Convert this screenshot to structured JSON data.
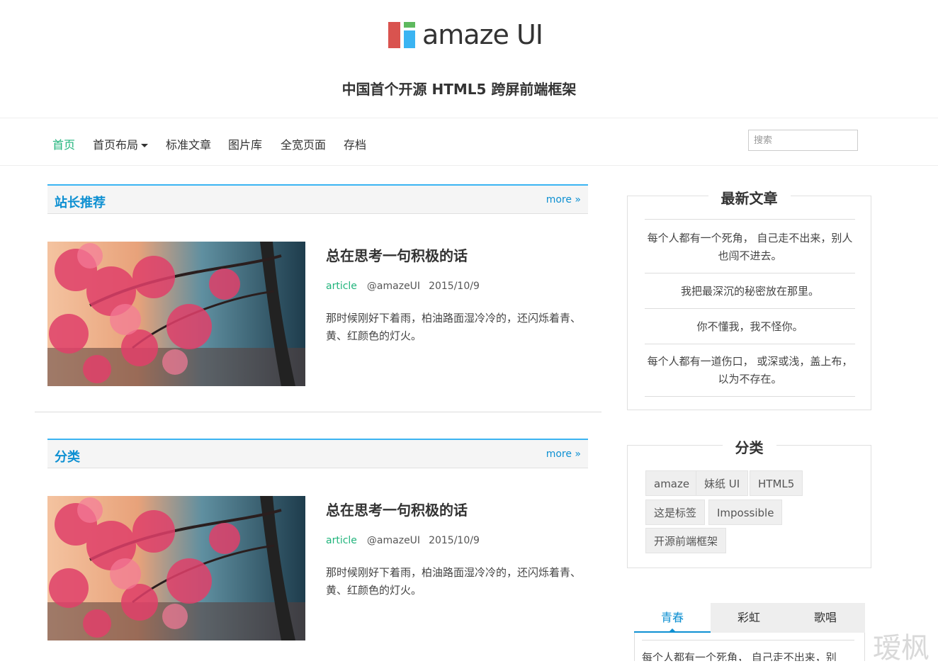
{
  "header": {
    "logo_text": "amaze UI",
    "tagline": "中国首个开源 HTML5 跨屏前端框架"
  },
  "nav": {
    "items": [
      "首页",
      "首页布局",
      "标准文章",
      "图片库",
      "全宽页面",
      "存档"
    ],
    "search_placeholder": "搜索"
  },
  "sections": [
    {
      "title": "站长推荐",
      "more": "more »",
      "post": {
        "title": "总在思考一句积极的话",
        "category": "article",
        "author": "@amazeUI",
        "date": "2015/10/9",
        "summary": "那时候刚好下着雨，柏油路面湿冷冷的，还闪烁着青、黄、红颜色的灯火。"
      }
    },
    {
      "title": "分类",
      "more": "more »",
      "post": {
        "title": "总在思考一句积极的话",
        "category": "article",
        "author": "@amazeUI",
        "date": "2015/10/9",
        "summary": "那时候刚好下着雨，柏油路面湿冷冷的，还闪烁着青、黄、红颜色的灯火。"
      }
    }
  ],
  "sidebar": {
    "latest": {
      "title": "最新文章",
      "items": [
        "每个人都有一个死角， 自己走不出来，别人也闯不进去。",
        "我把最深沉的秘密放在那里。",
        "你不懂我，我不怪你。",
        "每个人都有一道伤口， 或深或浅，盖上布，以为不存在。"
      ]
    },
    "categories": {
      "title": "分类",
      "tags": [
        "amaze",
        "妹纸 UI",
        "HTML5",
        "这是标签",
        "Impossible",
        "开源前端框架"
      ]
    },
    "tabs": {
      "labels": [
        "青春",
        "彩虹",
        "歌唱"
      ],
      "active_text": "每个人都有一个死角， 自己走不出来，别"
    }
  },
  "watermark": "瑷枫",
  "colors": {
    "accent_green": "#21b47c",
    "accent_blue": "#0e90d2",
    "section_border": "#3bb4f2"
  }
}
